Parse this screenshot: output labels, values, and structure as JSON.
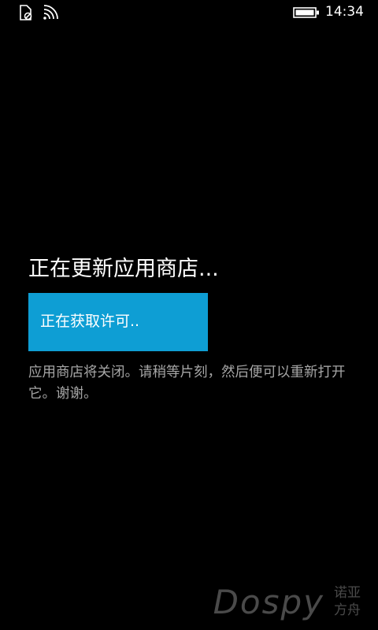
{
  "status_bar": {
    "time": "14:34",
    "icons": [
      "sim-no-service-icon",
      "wifi-signal-icon",
      "battery-icon"
    ]
  },
  "main": {
    "title": "正在更新应用商店...",
    "progress_text": "正在获取许可..",
    "message": "应用商店将关闭。请稍等片刻，然后便可以重新打开它。谢谢。"
  },
  "watermark": {
    "brand": "Dospy",
    "line1": "诺亚",
    "line2": "方舟"
  },
  "colors": {
    "background": "#000000",
    "accent": "#0e9ed4",
    "secondary_text": "#a6a6a6",
    "watermark": "#4a4a4a"
  }
}
